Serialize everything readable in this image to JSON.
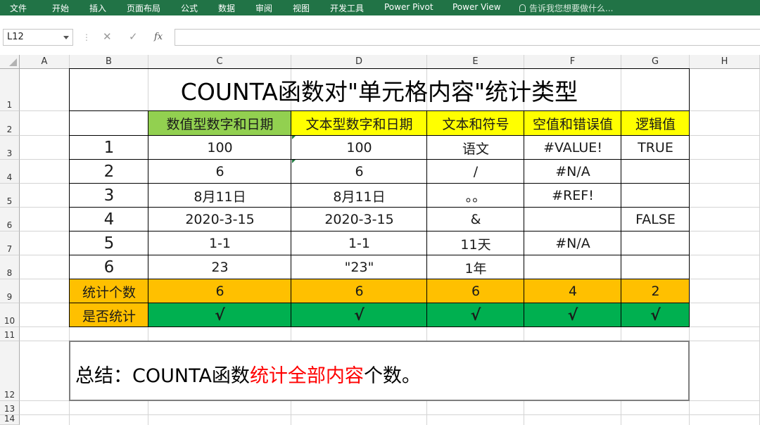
{
  "ribbon": {
    "tabs": [
      "文件",
      "开始",
      "插入",
      "页面布局",
      "公式",
      "数据",
      "审阅",
      "视图",
      "开发工具",
      "Power Pivot",
      "Power View"
    ],
    "tell_me": "告诉我您想要做什么..."
  },
  "formula_bar": {
    "name_box": "L12",
    "cancel_icon": "✕",
    "enter_icon": "✓",
    "fx_label": "fx",
    "formula": ""
  },
  "columns": [
    "A",
    "B",
    "C",
    "D",
    "E",
    "F",
    "G",
    "H"
  ],
  "rows": [
    "1",
    "2",
    "3",
    "4",
    "5",
    "6",
    "7",
    "8",
    "9",
    "10",
    "11",
    "12",
    "13",
    "14"
  ],
  "sheet": {
    "title": "COUNTA函数对\"单元格内容\"统计类型",
    "headers": [
      "数值型数字和日期",
      "文本型数字和日期",
      "文本和符号",
      "空值和错误值",
      "逻辑值"
    ],
    "data_rows": [
      {
        "index": "1",
        "cells": [
          "100",
          "100",
          "语文",
          "#VALUE!",
          "TRUE"
        ]
      },
      {
        "index": "2",
        "cells": [
          "6",
          "6",
          "/",
          "#N/A",
          ""
        ]
      },
      {
        "index": "3",
        "cells": [
          "8月11日",
          "8月11日",
          "。。",
          "#REF!",
          ""
        ]
      },
      {
        "index": "4",
        "cells": [
          "2020-3-15",
          "2020-3-15",
          "&",
          "",
          "FALSE"
        ]
      },
      {
        "index": "5",
        "cells": [
          "1-1",
          "1-1",
          "11天",
          "#N/A",
          ""
        ]
      },
      {
        "index": "6",
        "cells": [
          "23",
          "\"23\"",
          "1年",
          "",
          ""
        ]
      }
    ],
    "count_row": {
      "label": "统计个数",
      "values": [
        "6",
        "6",
        "6",
        "4",
        "2"
      ]
    },
    "counted_row": {
      "label": "是否统计",
      "values": [
        "√",
        "√",
        "√",
        "√",
        "√"
      ]
    },
    "summary": {
      "prefix": "总结：COUNTA函数",
      "highlight": "统计全部内容",
      "suffix": "个数。"
    }
  },
  "colors": {
    "ribbon": "#217346",
    "header_green": "#92d050",
    "header_yellow": "#ffff00",
    "count_orange": "#ffc000",
    "counted_green": "#00b050",
    "highlight_red": "#ff0000"
  }
}
